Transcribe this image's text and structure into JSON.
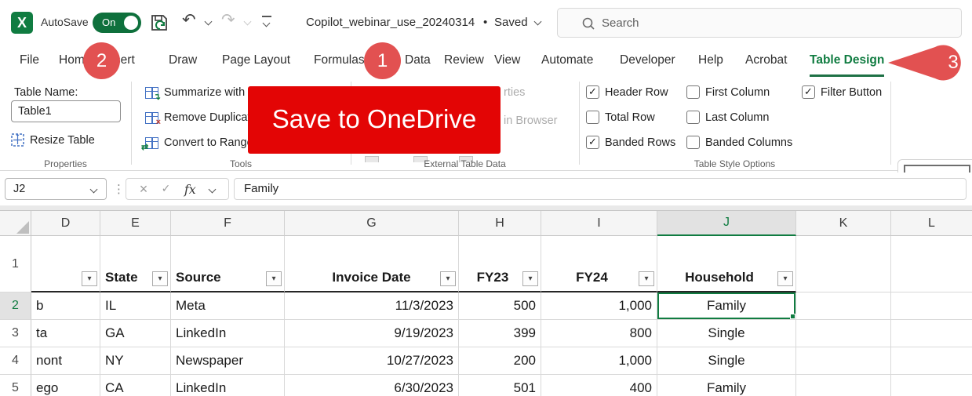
{
  "colors": {
    "excel_green": "#107C41",
    "badge_red": "#E25151",
    "banner_red": "#E30505",
    "selection_green": "#107C41"
  },
  "icons": {
    "filter_arrow": "▾",
    "check": "✓",
    "cancel": "×",
    "undo": "↶",
    "redo": "↷",
    "ellipsis": "⋮",
    "bullet": "•",
    "excel_logo_letter": "X",
    "remove_x": "×",
    "sync": "↻",
    "arrows": "⇄",
    "resize": "⤢",
    "pivot_plus": "↴"
  },
  "titlebar": {
    "autosave_label": "AutoSave",
    "autosave_state": "On",
    "doc_title": "Copilot_webinar_use_20240314",
    "doc_status": "Saved",
    "search_placeholder": "Search"
  },
  "tabs": [
    "File",
    "Home",
    "Insert",
    "Draw",
    "Page Layout",
    "Formulas",
    "Data",
    "Review",
    "View",
    "Automate",
    "Developer",
    "Help",
    "Acrobat",
    "Table Design"
  ],
  "annotations": {
    "step_1": "1",
    "step_2": "2",
    "step_3": "3",
    "banner": "Save to OneDrive"
  },
  "ribbon": {
    "properties": {
      "label": "Properties",
      "table_name_label": "Table Name:",
      "table_name_value": "Table1",
      "resize_button": "Resize Table"
    },
    "tools": {
      "label": "Tools",
      "items": [
        "Summarize with PivotTable",
        "Remove Duplicates",
        "Convert to Range"
      ]
    },
    "external": {
      "label": "External Table Data",
      "fragment_1": "rties",
      "fragment_2": "in Browser"
    },
    "style_options": {
      "label": "Table Style Options",
      "col1": [
        {
          "label": "Header Row",
          "checked": true
        },
        {
          "label": "Total Row",
          "checked": false
        },
        {
          "label": "Banded Rows",
          "checked": true
        }
      ],
      "col2": [
        {
          "label": "First Column",
          "checked": false
        },
        {
          "label": "Last Column",
          "checked": false
        },
        {
          "label": "Banded Columns",
          "checked": false
        }
      ],
      "col3": [
        {
          "label": "Filter Button",
          "checked": true
        }
      ]
    }
  },
  "formula_bar": {
    "cell_reference": "J2",
    "fx_label": "fx",
    "formula_value": "Family"
  },
  "sheet": {
    "columns": [
      "D",
      "E",
      "F",
      "G",
      "H",
      "I",
      "J",
      "K",
      "L"
    ],
    "selected_column": "J",
    "row_numbers": [
      "1",
      "2",
      "3",
      "4",
      "5"
    ],
    "selected_cell": "J2",
    "header": [
      "",
      "State",
      "Source",
      "Invoice Date",
      "FY23",
      "FY24",
      "Household",
      "",
      ""
    ],
    "data": [
      [
        "b",
        "IL",
        "Meta",
        "11/3/2023",
        "500",
        "1,000",
        "Family",
        "",
        ""
      ],
      [
        "ta",
        "GA",
        "LinkedIn",
        "9/19/2023",
        "399",
        "800",
        "Single",
        "",
        ""
      ],
      [
        "nont",
        "NY",
        "Newspaper",
        "10/27/2023",
        "200",
        "1,000",
        "Single",
        "",
        ""
      ],
      [
        "ego",
        "CA",
        "LinkedIn",
        "6/30/2023",
        "501",
        "400",
        "Family",
        "",
        ""
      ]
    ]
  }
}
